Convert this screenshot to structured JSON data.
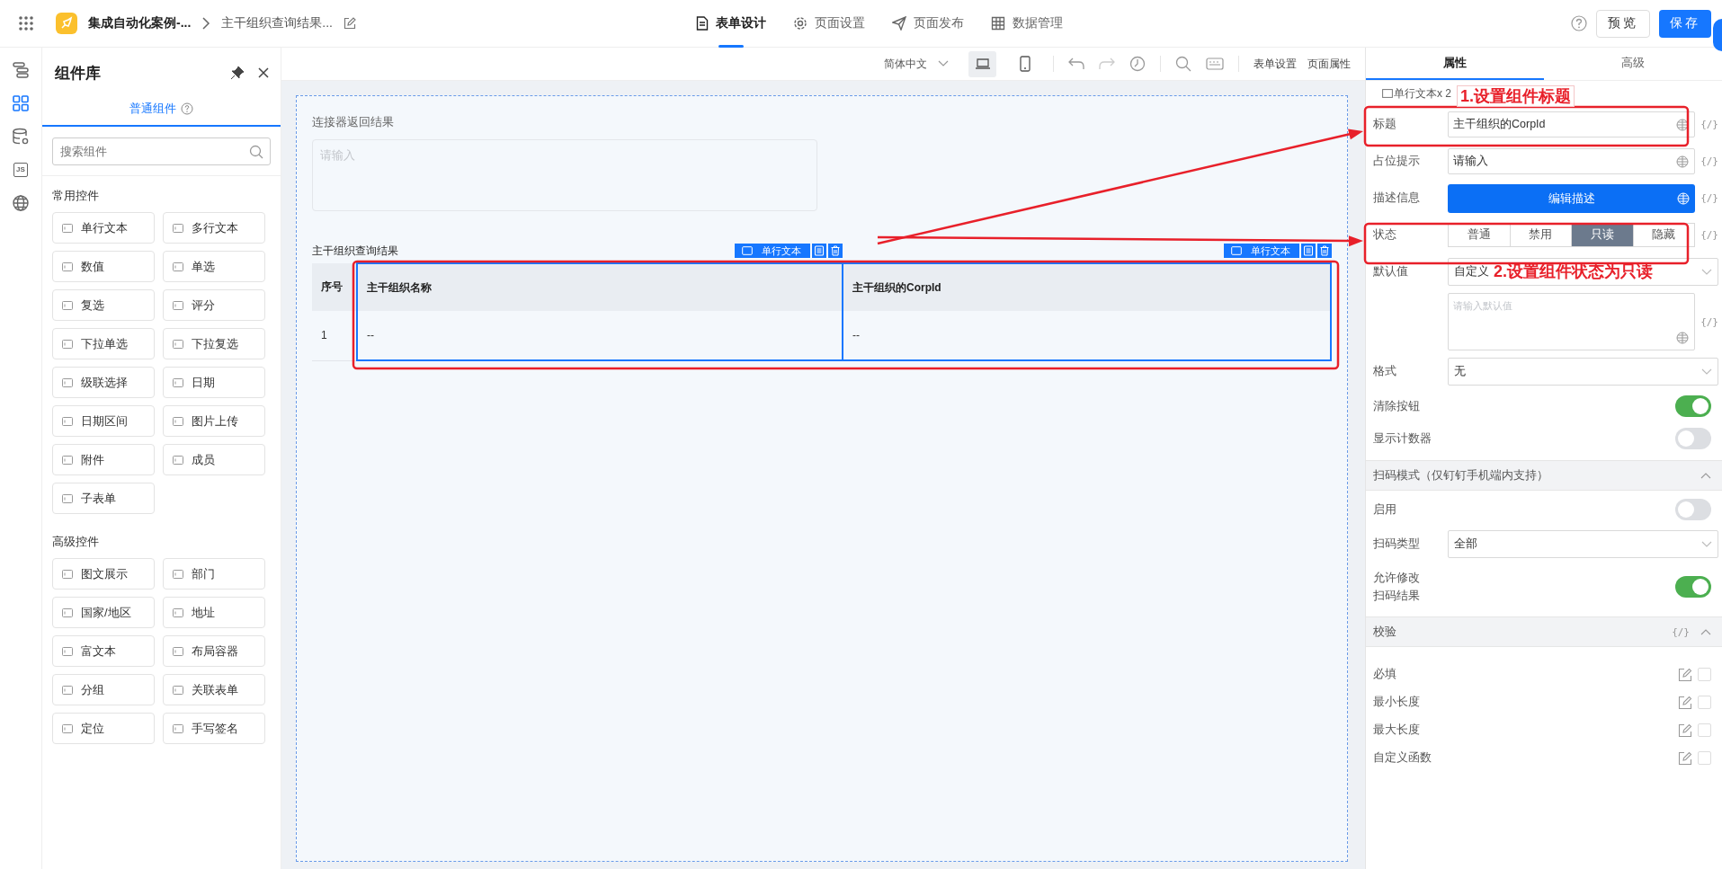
{
  "app": {
    "name": "集成自动化案例-...",
    "page": "主干组织查询结果..."
  },
  "nav_tabs": [
    {
      "label": "表单设计",
      "selected": true
    },
    {
      "label": "页面设置",
      "selected": false
    },
    {
      "label": "页面发布",
      "selected": false
    },
    {
      "label": "数据管理",
      "selected": false
    }
  ],
  "header_buttons": [
    {
      "label": "预览",
      "kind": "secondary"
    },
    {
      "label": "保存",
      "kind": "primary"
    }
  ],
  "side_rail": [
    {
      "selected": false
    },
    {
      "selected": true
    },
    {
      "selected": false
    },
    {
      "selected": false,
      "label": "JS"
    },
    {
      "selected": false
    }
  ],
  "component_panel": {
    "title": "组件库",
    "tab": "普通组件",
    "search_placeholder": "搜索组件",
    "groups": [
      {
        "title": "常用控件",
        "items": [
          "单行文本",
          "多行文本",
          "数值",
          "单选",
          "复选",
          "评分",
          "下拉单选",
          "下拉复选",
          "级联选择",
          "日期",
          "日期区间",
          "图片上传",
          "附件",
          "成员",
          "子表单"
        ]
      },
      {
        "title": "高级控件",
        "items": [
          "图文展示",
          "部门",
          "国家/地区",
          "地址",
          "富文本",
          "布局容器",
          "分组",
          "关联表单",
          "定位",
          "手写签名"
        ]
      }
    ]
  },
  "toolbar": {
    "language": "简体中文",
    "devices": [
      {
        "selected": true
      },
      {
        "selected": false
      }
    ],
    "links": [
      "表单设置",
      "页面属性"
    ]
  },
  "canvas": {
    "text_area": {
      "label": "连接器返回结果",
      "placeholder": "请输入"
    },
    "table": {
      "title": "主干组织查询结果",
      "columns": [
        {
          "label": "序号",
          "selected": false
        },
        {
          "label": "主干组织名称",
          "selected": true,
          "chip": "单行文本"
        },
        {
          "label": "主干组织的CorpId",
          "selected": true,
          "chip": "单行文本"
        }
      ],
      "rows": [
        [
          "1",
          "--",
          "--"
        ]
      ]
    }
  },
  "properties": {
    "tabs": [
      {
        "label": "属性",
        "selected": true
      },
      {
        "label": "高级",
        "selected": false
      }
    ],
    "selection": "单行文本x 2",
    "title_field": {
      "label": "标题",
      "value": "主干组织的CorpId",
      "expr": "{/}"
    },
    "placeholder_field": {
      "label": "占位提示",
      "value": "请输入",
      "expr": "{/}"
    },
    "description": {
      "label": "描述信息",
      "button": "编辑描述",
      "expr": "{/}"
    },
    "state": {
      "label": "状态",
      "expr": "{/}",
      "options": [
        {
          "label": "普通",
          "selected": false
        },
        {
          "label": "禁用",
          "selected": false
        },
        {
          "label": "只读",
          "selected": true
        },
        {
          "label": "隐藏",
          "selected": false
        }
      ]
    },
    "default_value": {
      "label": "默认值",
      "value": "自定义",
      "textarea_placeholder": "请输入默认值",
      "expr": "{/}"
    },
    "format": {
      "label": "格式",
      "value": "无"
    },
    "switches": [
      {
        "label": "清除按钮",
        "on": true
      },
      {
        "label": "显示计数器",
        "on": false
      }
    ],
    "scan": {
      "title": "扫码模式（仅钉钉手机端内支持）",
      "expanded": true,
      "enable": {
        "label": "启用",
        "on": false
      },
      "type": {
        "label": "扫码类型",
        "value": "全部"
      },
      "allow_edit": {
        "label": "允许修改扫码结果",
        "on": true
      }
    },
    "validation": {
      "title": "校验",
      "expr": "{/}",
      "expanded": true,
      "rules": [
        {
          "label": "必填",
          "checked": false
        },
        {
          "label": "最小长度",
          "checked": false
        },
        {
          "label": "最大长度",
          "checked": false
        },
        {
          "label": "自定义函数",
          "checked": false
        }
      ]
    }
  },
  "annotations": [
    {
      "text": "1.设置组件标题"
    },
    {
      "text": "2.设置组件状态为只读"
    }
  ]
}
